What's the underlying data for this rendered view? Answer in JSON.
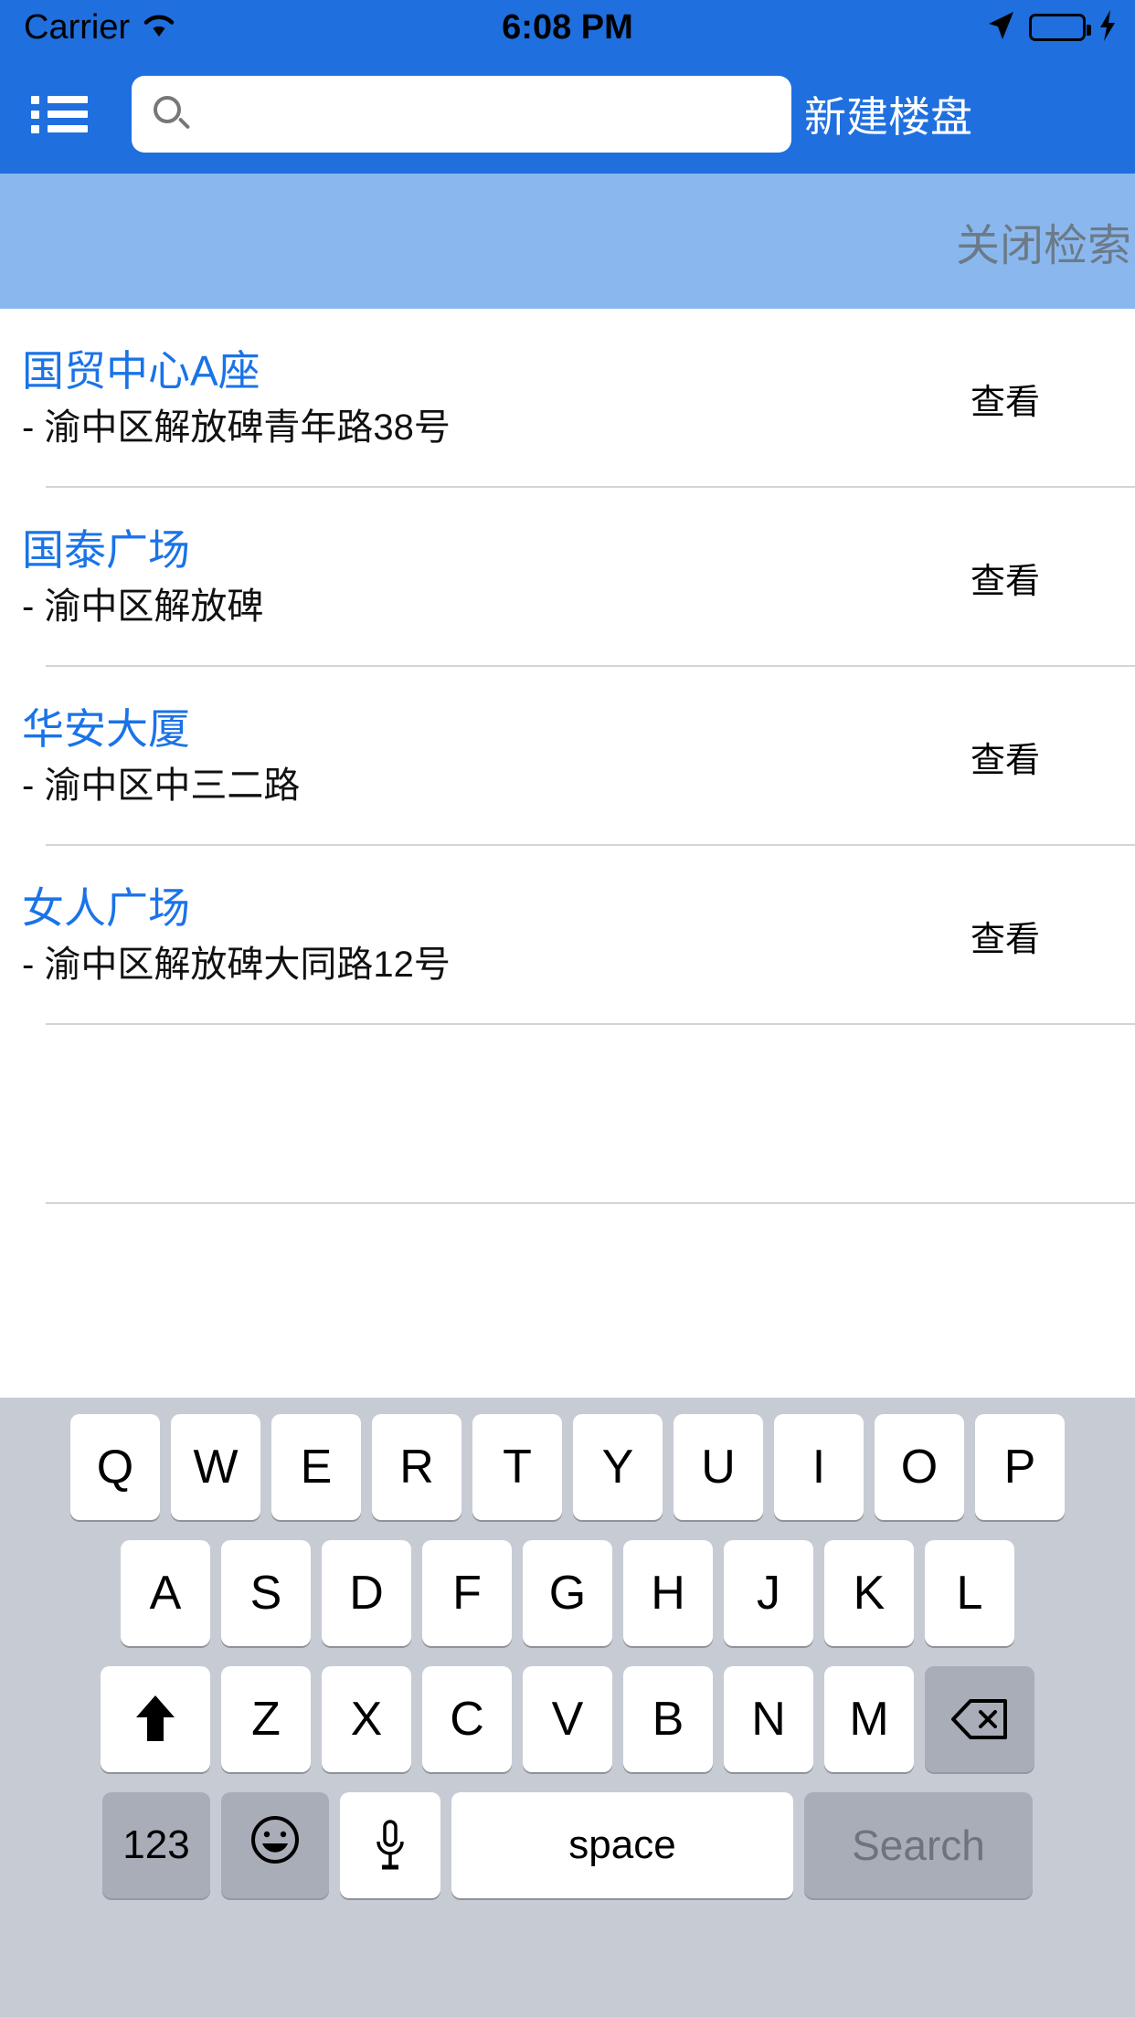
{
  "status_bar": {
    "carrier": "Carrier",
    "wifi_icon": "wifi-icon",
    "time": "6:08 PM",
    "location_icon": "location-arrow-icon",
    "battery_icon": "battery-icon",
    "charging_icon": "lightning-bolt-icon",
    "battery_color": "#4cd662"
  },
  "nav_bar": {
    "menu_icon": "list-menu-icon",
    "search_icon": "search-icon",
    "search_value": "",
    "search_placeholder": "",
    "action_label": "新建楼盘",
    "background_color": "#1f6fde"
  },
  "banner": {
    "close_search_label": "关闭检索",
    "background_color": "#8ab8ee",
    "text_color": "#6c7a88"
  },
  "results": {
    "action_label": "查看",
    "items": [
      {
        "title": "国贸中心A座",
        "address": "- 渝中区解放碑青年路38号",
        "action": "查看"
      },
      {
        "title": "国泰广场",
        "address": "- 渝中区解放碑",
        "action": "查看"
      },
      {
        "title": "华安大厦",
        "address": "- 渝中区中三二路",
        "action": "查看"
      },
      {
        "title": "女人广场",
        "address": "- 渝中区解放碑大同路12号",
        "action": "查看"
      }
    ],
    "title_color": "#1a73e8"
  },
  "keyboard": {
    "row1": [
      "Q",
      "W",
      "E",
      "R",
      "T",
      "Y",
      "U",
      "I",
      "O",
      "P"
    ],
    "row2": [
      "A",
      "S",
      "D",
      "F",
      "G",
      "H",
      "J",
      "K",
      "L"
    ],
    "row3": [
      "Z",
      "X",
      "C",
      "V",
      "B",
      "N",
      "M"
    ],
    "shift_icon": "shift-arrow-icon",
    "delete_icon": "backspace-delete-icon",
    "numbers_label": "123",
    "emoji_icon": "smiley-face-icon",
    "mic_icon": "microphone-icon",
    "space_label": "space",
    "return_label": "Search",
    "background_color": "#c7cbd4"
  }
}
